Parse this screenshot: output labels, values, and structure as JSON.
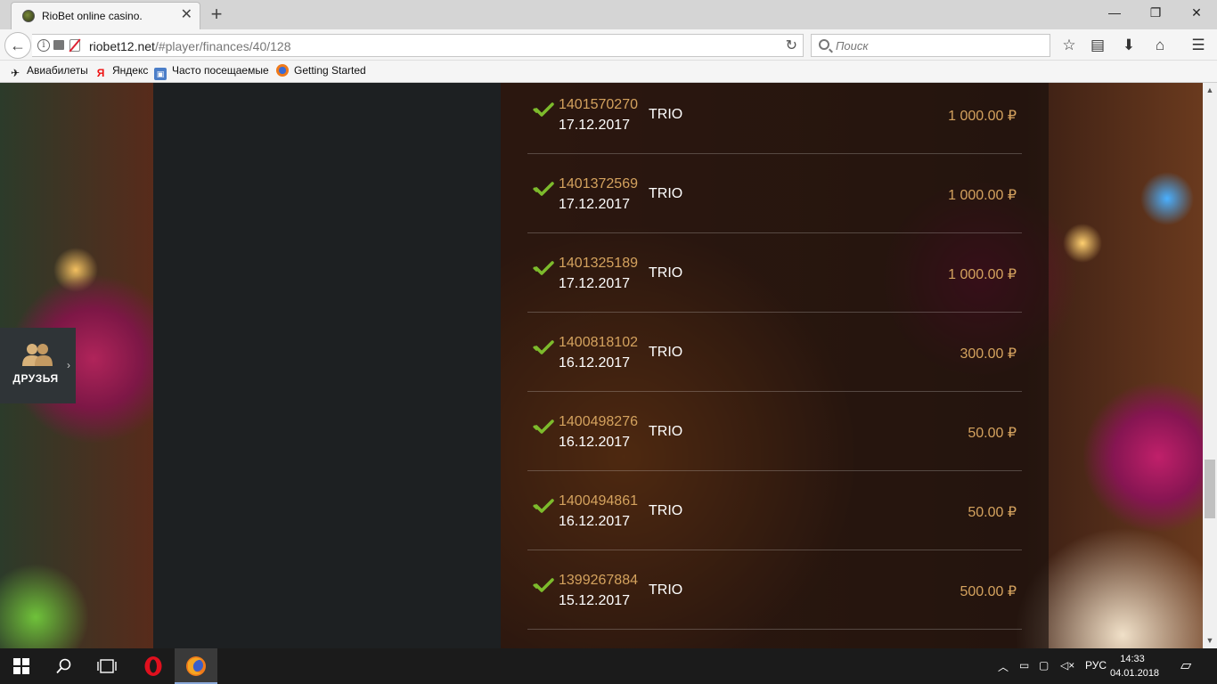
{
  "browser": {
    "tab_title": "RioBet online casino.",
    "url_domain": "riobet12.net",
    "url_path": "/#player/finances/40/128",
    "search_placeholder": "Поиск"
  },
  "bookmarks": [
    {
      "label": "Авиабилеты",
      "icon": "plane-icon"
    },
    {
      "label": "Яндекс",
      "icon": "yandex-icon"
    },
    {
      "label": "Часто посещаемые",
      "icon": "folder-icon"
    },
    {
      "label": "Getting Started",
      "icon": "firefox-icon"
    }
  ],
  "friends_widget": {
    "label": "ДРУЗЬЯ"
  },
  "transactions": [
    {
      "id": "1401570270",
      "date": "17.12.2017",
      "method": "TRIO",
      "amount": "1 000.00 ₽",
      "status": "success"
    },
    {
      "id": "1401372569",
      "date": "17.12.2017",
      "method": "TRIO",
      "amount": "1 000.00 ₽",
      "status": "success"
    },
    {
      "id": "1401325189",
      "date": "17.12.2017",
      "method": "TRIO",
      "amount": "1 000.00 ₽",
      "status": "success"
    },
    {
      "id": "1400818102",
      "date": "16.12.2017",
      "method": "TRIO",
      "amount": "300.00 ₽",
      "status": "success"
    },
    {
      "id": "1400498276",
      "date": "16.12.2017",
      "method": "TRIO",
      "amount": "50.00 ₽",
      "status": "success"
    },
    {
      "id": "1400494861",
      "date": "16.12.2017",
      "method": "TRIO",
      "amount": "50.00 ₽",
      "status": "success"
    },
    {
      "id": "1399267884",
      "date": "15.12.2017",
      "method": "TRIO",
      "amount": "500.00 ₽",
      "status": "success"
    }
  ],
  "taskbar": {
    "language": "РУС",
    "time": "14:33",
    "date": "04.01.2018"
  },
  "colors": {
    "accent_gold": "#d4a25e",
    "success_green": "#7dbb2c",
    "panel_dark": "#1d2022"
  }
}
